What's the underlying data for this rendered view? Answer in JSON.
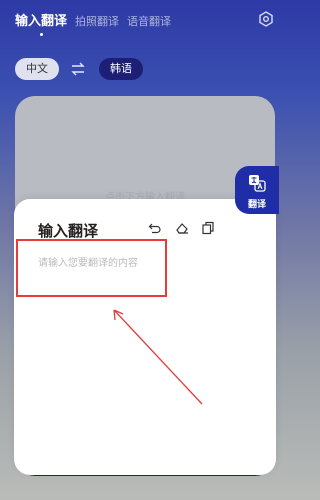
{
  "tabs": {
    "input": "输入翻译",
    "photo": "拍照翻译",
    "voice": "语音翻译"
  },
  "languages": {
    "source": "中文",
    "target": "韩语"
  },
  "background_card": {
    "hint": "点击下方输入翻译"
  },
  "sheet": {
    "title": "输入翻译",
    "placeholder": "请输入您要翻译的内容"
  },
  "badge": {
    "label": "翻译"
  },
  "icons": [
    "gear-icon",
    "swap-icon",
    "undo-icon",
    "eraser-icon",
    "copy-icon",
    "translate-icon"
  ],
  "colors": {
    "accent": "#1f2ea6",
    "highlight": "#e53b3b"
  }
}
